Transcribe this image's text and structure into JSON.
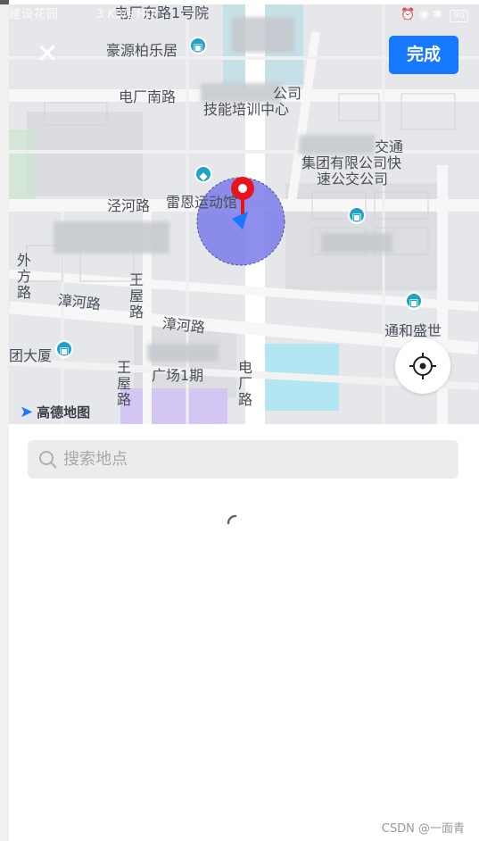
{
  "status_bar": {
    "left_text": "建设花园",
    "network": "3 KB/s HD",
    "battery": "90"
  },
  "header": {
    "close_icon": "close-icon",
    "done_label": "完成"
  },
  "map": {
    "labels": {
      "top_road": "电厂东路1号院",
      "haoyuan": "豪源柏乐居",
      "dianchang_south": "电厂南路",
      "company_suffix": "公司",
      "training_center": "技能培训中心",
      "bus_co_line1": "交通",
      "bus_co_line2": "集团有限公司快",
      "bus_co_line3": "速公交公司",
      "jinghe_road": "泾河路",
      "leien_gym": "雷恩运动馆",
      "waifang_road": "外方路",
      "zhanghe_road_1": "漳河路",
      "wangwu_road_1": "王屋路",
      "zhanghe_road_2": "漳河路",
      "tonghe": "通和盛世",
      "building": "团大厦",
      "wangwu_road_2": "王屋路",
      "plaza": "广场1期",
      "dianchang_road": "电厂路"
    },
    "logo_text": "高德地图",
    "colors": {
      "accent": "#1677ff",
      "radius_fill": "#7b7bea",
      "pin": "#e8141c",
      "water": "#b3e5f2",
      "park": "#d4c6f2"
    }
  },
  "search": {
    "placeholder": "搜索地点"
  },
  "watermark": "CSDN @一面青"
}
